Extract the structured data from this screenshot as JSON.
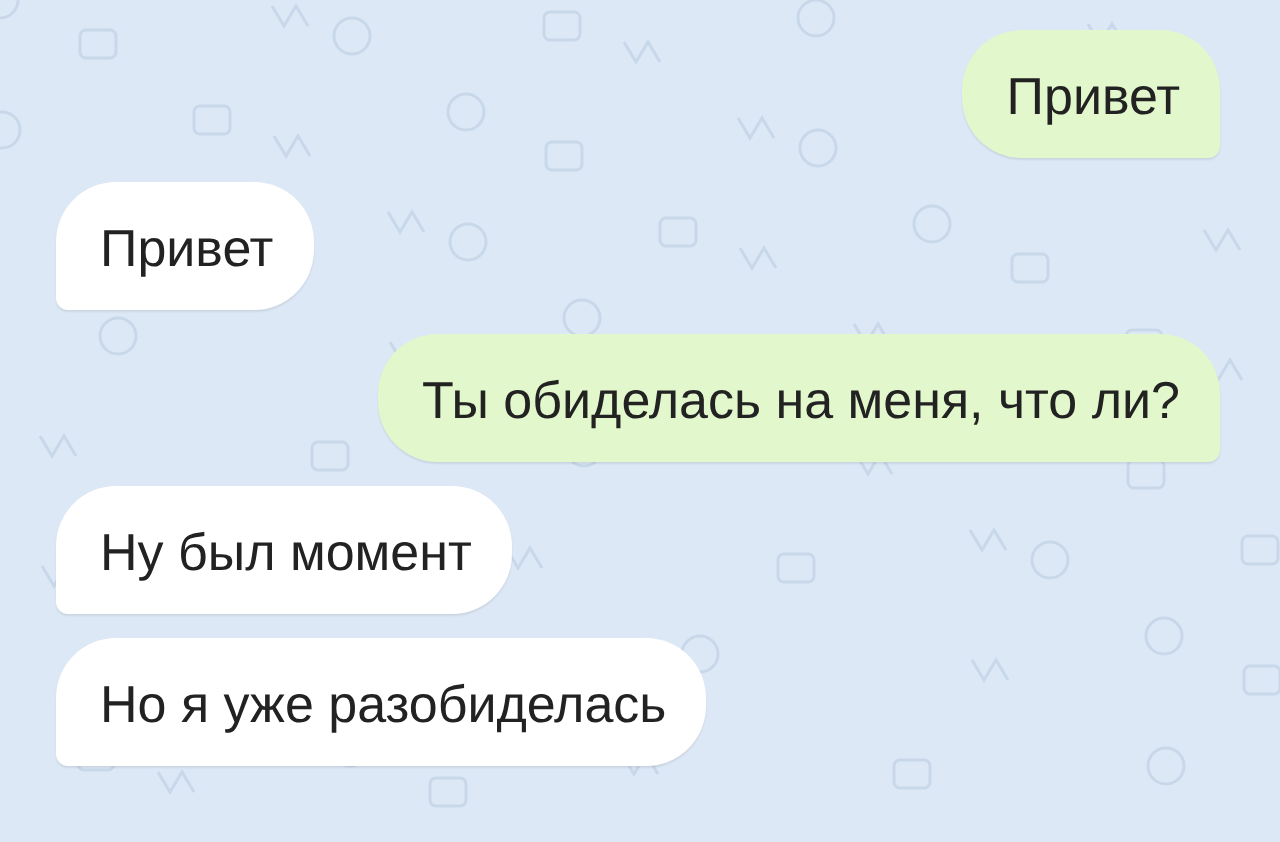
{
  "messages": [
    {
      "kind": "outgoing",
      "text": "Привет"
    },
    {
      "kind": "incoming",
      "text": "Привет"
    },
    {
      "kind": "outgoing",
      "text": "Ты обиделась на меня, что ли?"
    },
    {
      "kind": "incoming",
      "text": "Ну был момент"
    },
    {
      "kind": "incoming",
      "text": "Но я уже разобиделась"
    }
  ]
}
